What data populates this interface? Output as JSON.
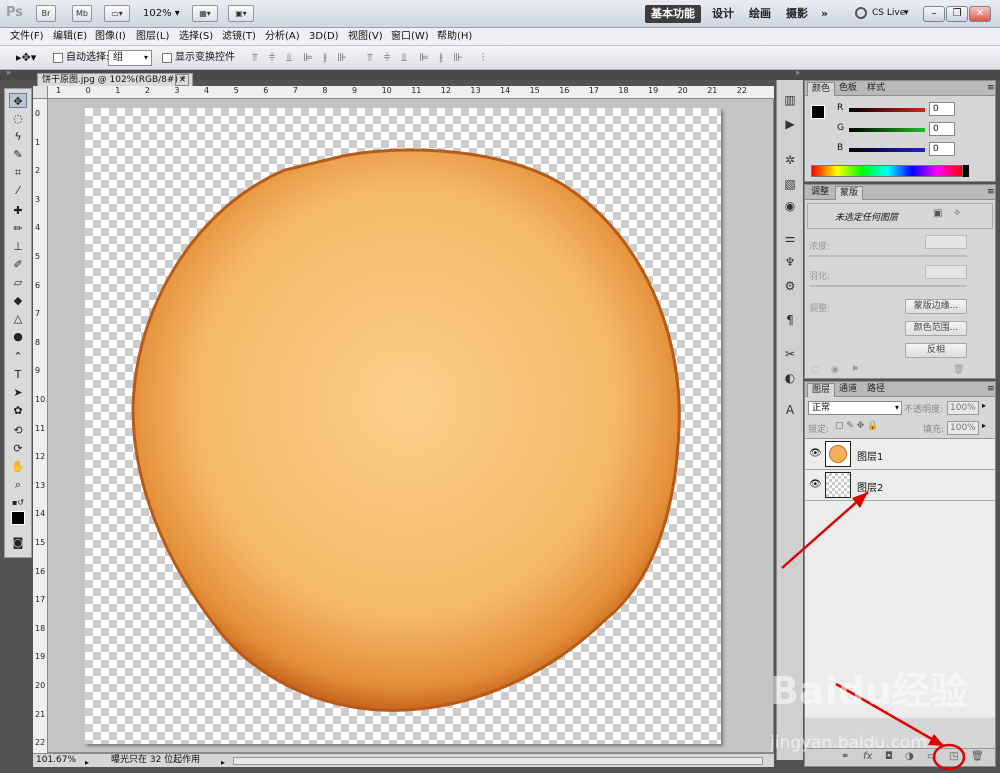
{
  "app": {
    "logo": "Ps",
    "zoom_dropdown": "102%",
    "workspaces": [
      "基本功能",
      "设计",
      "绘画",
      "摄影"
    ],
    "more": "»",
    "cslive": "CS Live",
    "small_btns": [
      "Br",
      "Mb"
    ]
  },
  "menu": [
    "文件(F)",
    "编辑(E)",
    "图像(I)",
    "图层(L)",
    "选择(S)",
    "滤镜(T)",
    "分析(A)",
    "3D(D)",
    "视图(V)",
    "窗口(W)",
    "帮助(H)"
  ],
  "options": {
    "auto_select_label": "自动选择:",
    "auto_select_value": "组",
    "show_transform_label": "显示变换控件"
  },
  "document": {
    "tab_title": "饼干原图.jpg @ 102%(RGB/8#) *",
    "close": "×",
    "ruler_h": [
      "1",
      "0",
      "1",
      "2",
      "3",
      "4",
      "5",
      "6",
      "7",
      "8",
      "9",
      "10",
      "11",
      "12",
      "13",
      "14",
      "15",
      "16",
      "17",
      "18",
      "19",
      "20",
      "21",
      "22"
    ],
    "ruler_v": [
      "0",
      "1",
      "2",
      "3",
      "4",
      "5",
      "6",
      "7",
      "8",
      "9",
      "10",
      "11",
      "12",
      "13",
      "14",
      "15",
      "16",
      "17",
      "18",
      "19",
      "20",
      "21",
      "22"
    ],
    "status_zoom": "101.67%",
    "status_text": "曝光只在 32 位起作用"
  },
  "color_panel": {
    "tabs": [
      "颜色",
      "色板",
      "样式"
    ],
    "channels": [
      {
        "name": "R",
        "value": "0",
        "color": "#e02020"
      },
      {
        "name": "G",
        "value": "0",
        "color": "#20c020"
      },
      {
        "name": "B",
        "value": "0",
        "color": "#2020e0"
      }
    ]
  },
  "adjust_panel": {
    "tabs": [
      "调整",
      "蒙版"
    ],
    "no_selection": "未选定任何图层",
    "density_label": "浓度:",
    "feather_label": "羽化:",
    "refine_label": "调整:",
    "btn_mask_edge": "蒙版边缘...",
    "btn_color_range": "颜色范围...",
    "btn_invert": "反相"
  },
  "layers_panel": {
    "tabs": [
      "图层",
      "通道",
      "路径"
    ],
    "blend_mode": "正常",
    "opacity_label": "不透明度:",
    "opacity_value": "100%",
    "lock_label": "锁定:",
    "fill_label": "填充:",
    "fill_value": "100%",
    "layers": [
      {
        "name": "图层1"
      },
      {
        "name": "图层2"
      }
    ]
  },
  "watermark": {
    "brand": "Baidu经验",
    "url": "jingyan.baidu.com"
  }
}
